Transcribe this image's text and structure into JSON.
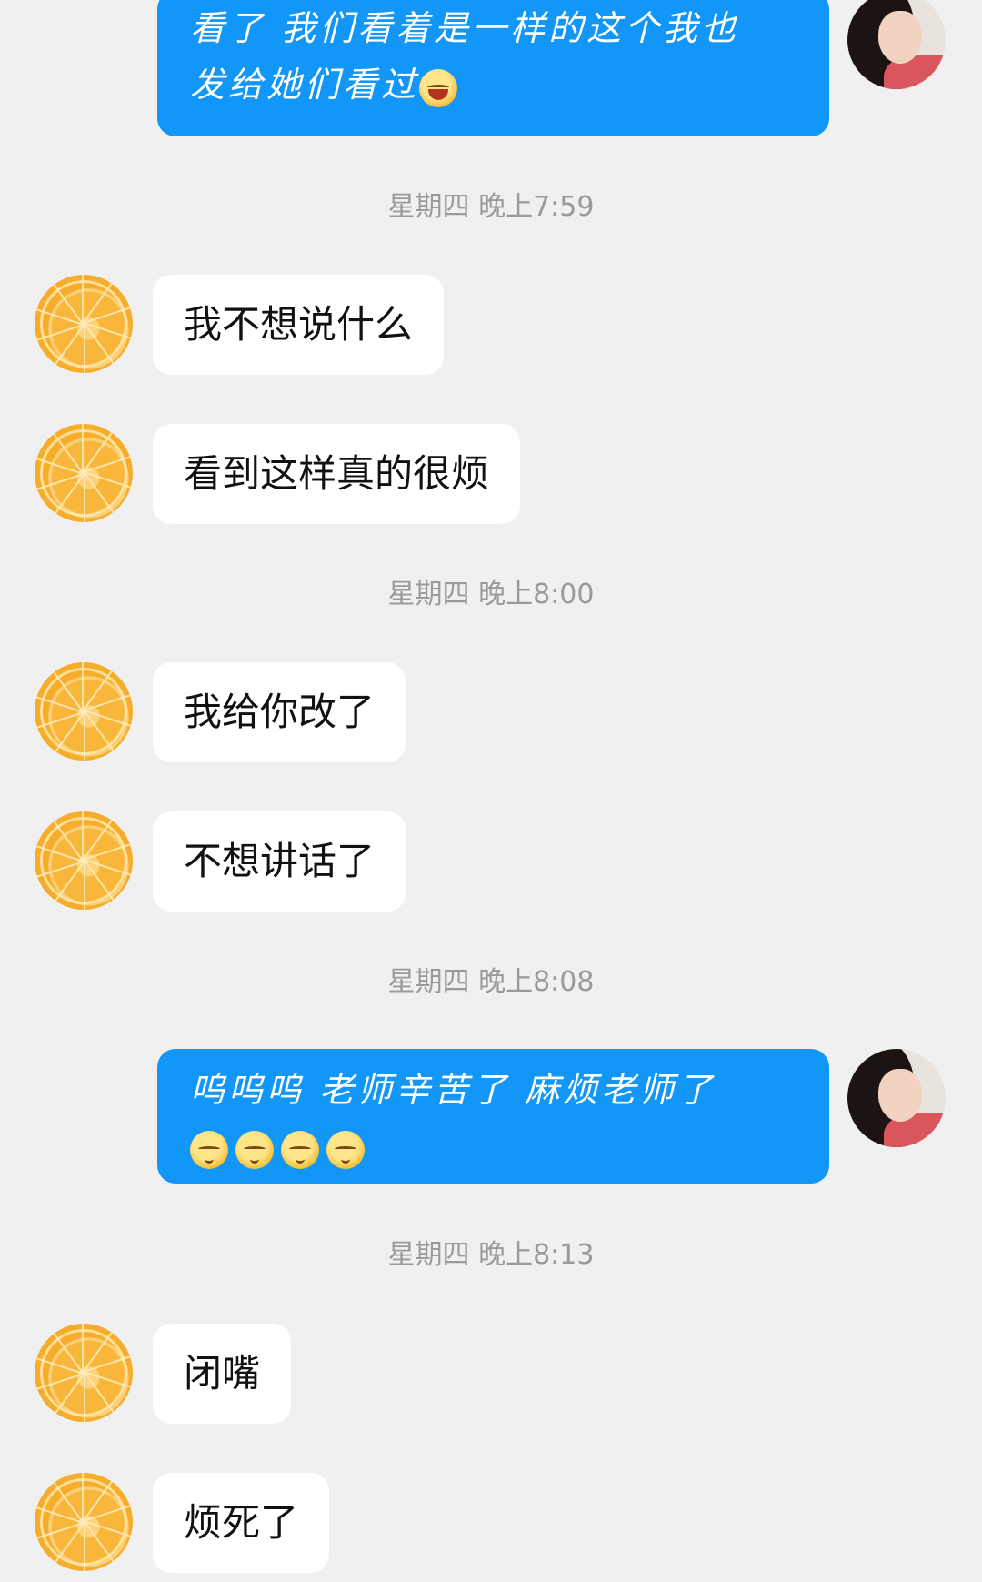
{
  "messages": [
    {
      "id": "m0",
      "side": "out",
      "text_line1": "看了 我们看着是一样的这个我也",
      "text_line2": "发给她们看过"
    },
    {
      "id": "t1",
      "timestamp": "星期四 晚上7:59"
    },
    {
      "id": "m1",
      "side": "in",
      "text": "我不想说什么"
    },
    {
      "id": "m2",
      "side": "in",
      "text": "看到这样真的很烦"
    },
    {
      "id": "t2",
      "timestamp": "星期四 晚上8:00"
    },
    {
      "id": "m3",
      "side": "in",
      "text": "我给你改了"
    },
    {
      "id": "m4",
      "side": "in",
      "text": "不想讲话了"
    },
    {
      "id": "t3",
      "timestamp": "星期四 晚上8:08"
    },
    {
      "id": "m5",
      "side": "out",
      "text_line1": "呜呜呜 老师辛苦了 麻烦老师了"
    },
    {
      "id": "t4",
      "timestamp": "星期四 晚上8:13"
    },
    {
      "id": "m6",
      "side": "in",
      "text": "闭嘴"
    },
    {
      "id": "m7",
      "side": "in",
      "text": "烦死了"
    }
  ],
  "colors": {
    "background": "#f0f0f0",
    "outgoing_bubble": "#1296f7",
    "incoming_bubble": "#ffffff",
    "timestamp_text": "#9a9a9a"
  },
  "icons": {
    "contact_avatar": "orange-slice-avatar",
    "self_avatar": "girl-photo-avatar",
    "emoji_laugh": "laughing-emoji",
    "emoji_sob": "sad-emoji"
  }
}
